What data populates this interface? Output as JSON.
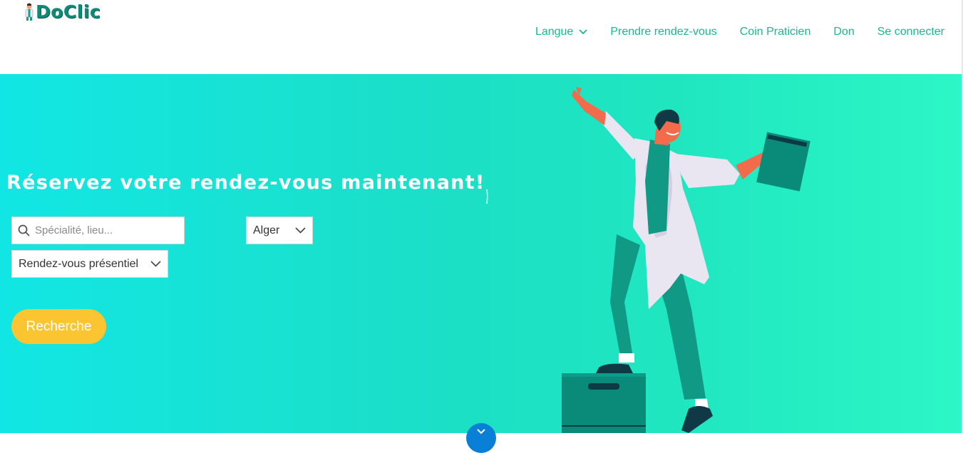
{
  "brand": {
    "name": "DoClic"
  },
  "nav": {
    "items": [
      {
        "label": "Langue",
        "has_dropdown": true
      },
      {
        "label": "Prendre rendez-vous"
      },
      {
        "label": "Coin Praticien"
      },
      {
        "label": "Don"
      },
      {
        "label": "Se connecter"
      }
    ]
  },
  "hero": {
    "title": "Réservez votre rendez-vous maintenant!",
    "search": {
      "placeholder": "Spécialité, lieu...",
      "value": ""
    },
    "city_select": {
      "value": "Alger"
    },
    "type_select": {
      "value": "Rendez-vous présentiel"
    },
    "search_button": "Recherche"
  },
  "colors": {
    "nav_text": "#19b98f",
    "hero_gradient_start": "#12e6e4",
    "hero_gradient_end": "#2cf7c6",
    "button": "#fbc531",
    "scroll_button": "#0a7fd6",
    "brand": "#0f8a76"
  },
  "icons": {
    "search": "search-icon",
    "dropdown": "chevron-down-icon",
    "scroll": "chevron-down-icon"
  }
}
